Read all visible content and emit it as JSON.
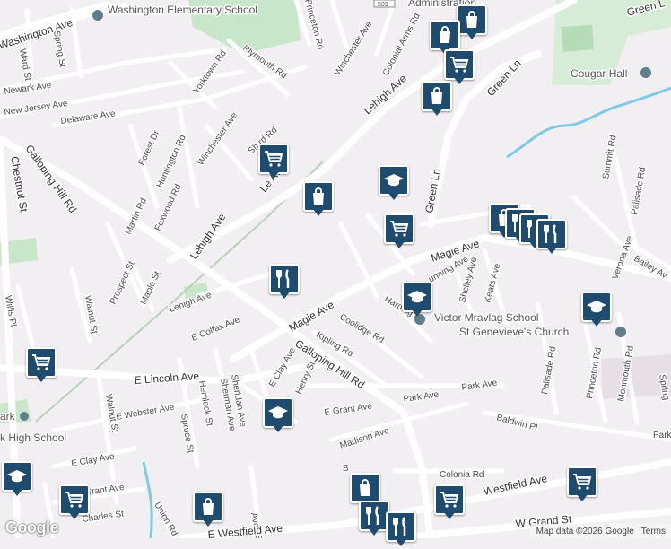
{
  "map": {
    "streets": {
      "washington_ave": "Washington Ave",
      "princeton_rd": "Princeton Rd",
      "spring_st": "Spring St",
      "ward_st": "Ward St",
      "newark_ave": "Newark Ave",
      "yorktown_rd": "Yorktown Rd",
      "plymouth_rd": "Plymouth Rd",
      "winchester_ave_top": "Winchester Ave",
      "colonial_arms_rd": "Colonial Arms Rd",
      "new_jersey_ave": "New Jersey Ave",
      "lehigh_ave_top": "Lehigh Ave",
      "green_ln_top": "Green Ln",
      "green_ln_mid": "Green Ln",
      "green_ln_right": "Green L",
      "delaware_ave": "Delaware Ave",
      "forest_dr": "Forest Dr",
      "huntington_rd": "Huntington Rd",
      "winchester_ave_mid": "Winchester Ave",
      "sh_rd": "Sh     rd Rd",
      "le_ave": "Le     Ave",
      "chestnut_st": "Chestnut St",
      "galloping_hill_rd_left": "Galloping Hill Rd",
      "martin_rd": "Martin Rd",
      "foxwood_rd": "Foxwood Rd",
      "lehigh_ave_mid": "Lehigh Ave",
      "summit_rd": "Summit Rd",
      "palisade_rd_top": "Palisade Rd",
      "magie_ave_right": "Magie Ave",
      "verona_ave": "Verona Ave",
      "bailey_ave": "Bailey Av",
      "prospect_st": "Prospect St",
      "maple_st": "Maple St",
      "lehigh_ave_low": "Lehigh Ave",
      "cunning_ave": "unning Ave",
      "shelley_ave": "Shelley Ave",
      "keats_ave": "Keats Ave",
      "walnut_st_top": "Walnut St",
      "willis_pl": "Willis Pl",
      "magie_ave_left": "Magie Ave",
      "harding_rd": "Harding Rd",
      "coolidge_rd": "Coolidge Rd",
      "e_colfax_ave": "E Colfax Ave",
      "kipling_rd": "Kipling Rd",
      "galloping_hill_rd_mid": "Galloping Hill Rd",
      "palisade_rd_low": "Palisade Rd",
      "princeton_rd_low": "Princeton Rd",
      "monmouth_rd": "Monmouth Rd",
      "spring_right": "Spring",
      "e_lincoln_ave": "E Lincoln Ave",
      "e_clay_ave_mid": "E Clay Ave",
      "henry_st": "Henry St",
      "sheridan_ave": "Sheridan Ave",
      "sherman_ave": "Sherman Ave",
      "hemlock_st": "Hemlock St",
      "park_ave": "Park Ave",
      "park_ave_2": "Park Ave",
      "walnut_st_low": "Walnut St",
      "e_webster_ave": "E Webster Ave",
      "e_grant_ave": "E Grant Ave",
      "spruce_st": "Spruce St",
      "baldwin_pl": "Baldwin Pl",
      "madison_ave": "Madison Ave",
      "park_right": "Park",
      "e_clay_ave_low": "E Clay Ave",
      "colonia_rd": "Colonia Rd",
      "grant_ave": "Grant Ave",
      "charles_st": "Charles St",
      "union_rd": "Union Rd",
      "avon_st": "Avon St",
      "e_westfield_ave": "E Westfield Ave",
      "westfield_ave_right": "Westfield Ave",
      "w_grand_st": "W Grand St",
      "b_rd": "B",
      "route_509": "509"
    },
    "pois": {
      "washington_school": "Washington Elementary School",
      "administration": "Administration",
      "cougar_hall": "Cougar Hall",
      "victor_mravlag_school": "Victor Mravlag School",
      "st_genevieves": "St Genevieve's Church",
      "park_left": "ark",
      "high_school": "k High School"
    },
    "colors": {
      "background": "#f2eff2",
      "road_major": "#ffffff",
      "road_minor": "#ffffff",
      "road_edge": "#d8d4d8",
      "park_green": "#c8e6c9",
      "water": "#7ec9e6",
      "marker": "#1f4b6e",
      "rail": "#b8d4b8"
    },
    "markers": [
      {
        "id": "shop-1",
        "icon": "shopping-bag-icon"
      },
      {
        "id": "shop-2",
        "icon": "shopping-bag-icon"
      },
      {
        "id": "cart-1",
        "icon": "shopping-cart-icon"
      },
      {
        "id": "shop-3",
        "icon": "shopping-bag-icon"
      },
      {
        "id": "cart-2",
        "icon": "shopping-cart-icon"
      },
      {
        "id": "shop-4",
        "icon": "shopping-bag-icon"
      },
      {
        "id": "school-1",
        "icon": "graduation-cap-icon"
      },
      {
        "id": "cart-3",
        "icon": "shopping-cart-icon"
      },
      {
        "id": "shop-5",
        "icon": "shopping-bag-icon"
      },
      {
        "id": "rest-1",
        "icon": "restaurant-icon"
      },
      {
        "id": "rest-2",
        "icon": "restaurant-icon"
      },
      {
        "id": "rest-3",
        "icon": "restaurant-icon"
      },
      {
        "id": "rest-4",
        "icon": "restaurant-icon"
      },
      {
        "id": "school-2",
        "icon": "graduation-cap-icon"
      },
      {
        "id": "school-3",
        "icon": "graduation-cap-icon"
      },
      {
        "id": "cart-4",
        "icon": "shopping-cart-icon"
      },
      {
        "id": "school-4",
        "icon": "graduation-cap-icon"
      },
      {
        "id": "school-5",
        "icon": "graduation-cap-icon"
      },
      {
        "id": "cart-5",
        "icon": "shopping-cart-icon"
      },
      {
        "id": "shop-6",
        "icon": "shopping-bag-icon"
      },
      {
        "id": "shop-7",
        "icon": "shopping-bag-icon"
      },
      {
        "id": "rest-5",
        "icon": "restaurant-icon"
      },
      {
        "id": "rest-6",
        "icon": "restaurant-icon"
      },
      {
        "id": "cart-6",
        "icon": "shopping-cart-icon"
      },
      {
        "id": "cart-7",
        "icon": "shopping-cart-icon"
      }
    ]
  },
  "footer": {
    "logo": "Google",
    "map_data": "Map data ©2026 Google",
    "terms": "Terms"
  }
}
